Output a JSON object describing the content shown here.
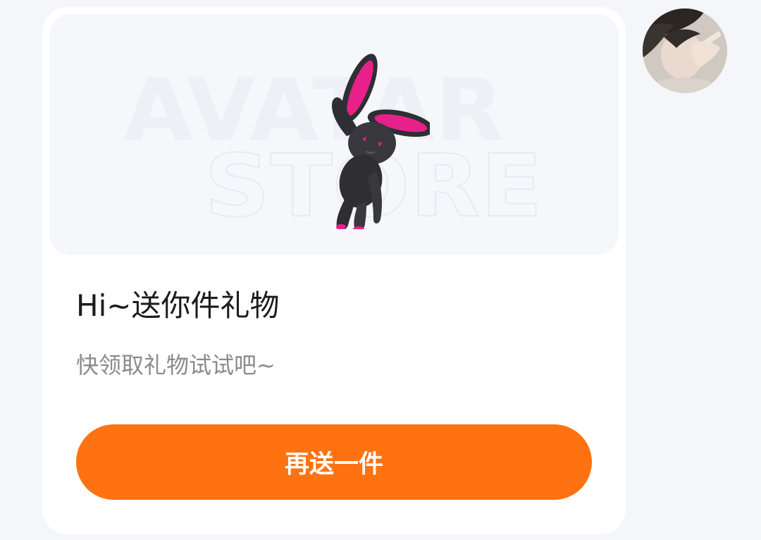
{
  "card": {
    "banner": {
      "watermark_line1": "AVATAR",
      "watermark_line2": "STORE"
    },
    "title": "Hi~送你件礼物",
    "subtitle": "快领取礼物试试吧~",
    "button_label": "再送一件"
  },
  "colors": {
    "accent": "#ff7212",
    "page_background": "#f4f6f9",
    "card_background": "#ffffff",
    "banner_background": "#f5f7fb",
    "title_text": "#1c1c1e",
    "subtitle_text": "#8a8a8f",
    "rabbit_body": "#2f2f33",
    "rabbit_accent": "#e8208a"
  },
  "icons": {
    "gift_image": "plush-rabbit-icon",
    "avatar": "user-avatar"
  }
}
